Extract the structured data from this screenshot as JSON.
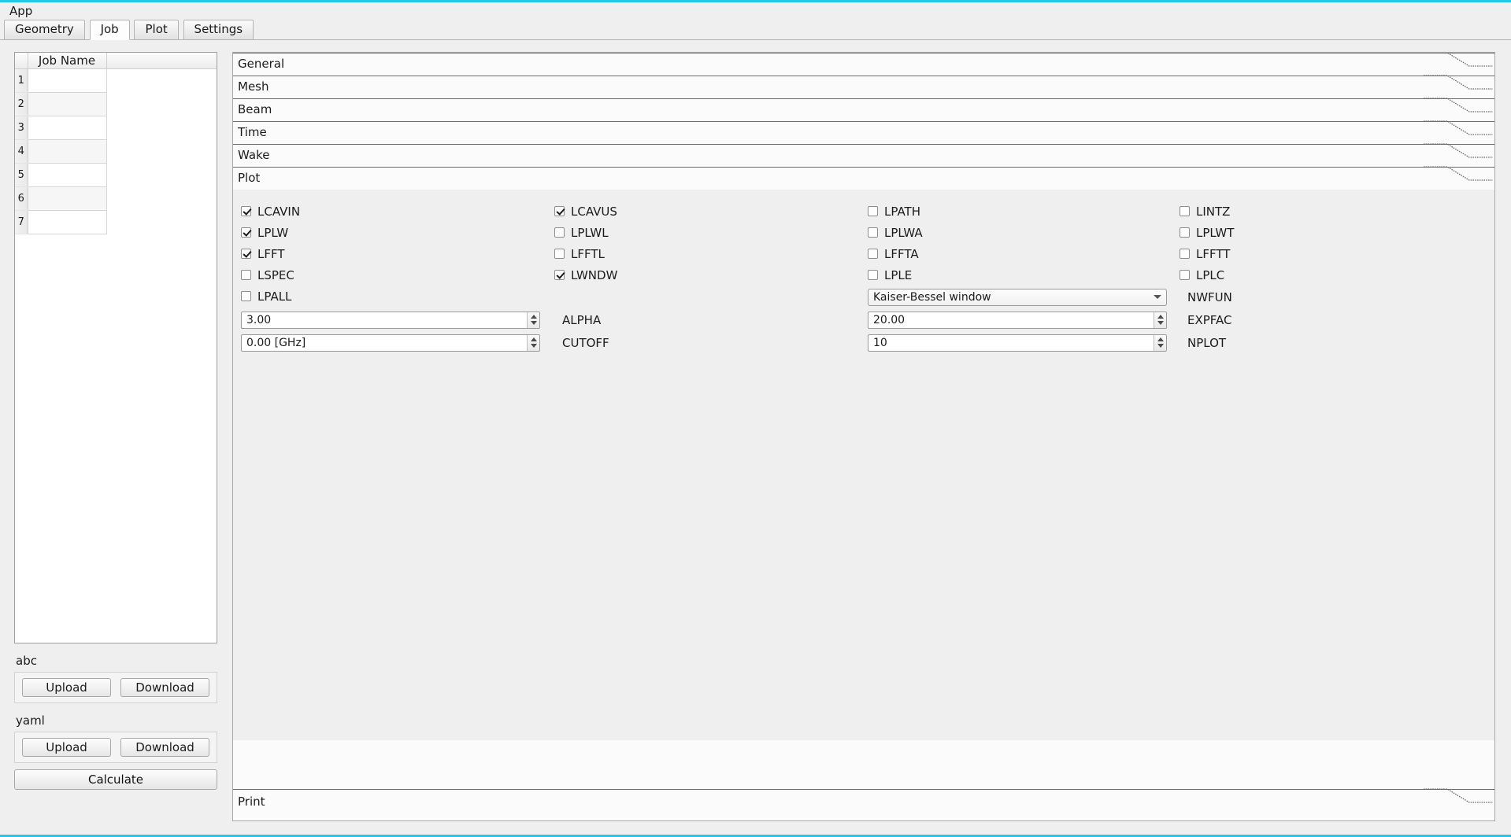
{
  "window": {
    "title": "App",
    "accent_color": "#22c8e8"
  },
  "tabs": [
    {
      "label": "Geometry",
      "active": false
    },
    {
      "label": "Job",
      "active": true
    },
    {
      "label": "Plot",
      "active": false
    },
    {
      "label": "Settings",
      "active": false
    }
  ],
  "job_table": {
    "column_header": "Job Name",
    "rows": [
      {
        "index": "1",
        "job_name": ""
      },
      {
        "index": "2",
        "job_name": ""
      },
      {
        "index": "3",
        "job_name": ""
      },
      {
        "index": "4",
        "job_name": ""
      },
      {
        "index": "5",
        "job_name": ""
      },
      {
        "index": "6",
        "job_name": ""
      },
      {
        "index": "7",
        "job_name": ""
      }
    ]
  },
  "io_groups": [
    {
      "label": "abc",
      "upload": "Upload",
      "download": "Download"
    },
    {
      "label": "yaml",
      "upload": "Upload",
      "download": "Download"
    }
  ],
  "calculate_label": "Calculate",
  "sections": [
    {
      "label": "General"
    },
    {
      "label": "Mesh"
    },
    {
      "label": "Beam"
    },
    {
      "label": "Time"
    },
    {
      "label": "Wake"
    },
    {
      "label": "Plot",
      "expanded": true
    }
  ],
  "print_section": {
    "label": "Print"
  },
  "plot": {
    "checkboxes": [
      {
        "name": "LCAVIN",
        "checked": true
      },
      {
        "name": "LCAVUS",
        "checked": true
      },
      {
        "name": "LPATH",
        "checked": false
      },
      {
        "name": "LINTZ",
        "checked": false
      },
      {
        "name": "LPLW",
        "checked": true
      },
      {
        "name": "LPLWL",
        "checked": false
      },
      {
        "name": "LPLWA",
        "checked": false
      },
      {
        "name": "LPLWT",
        "checked": false
      },
      {
        "name": "LFFT",
        "checked": true
      },
      {
        "name": "LFFTL",
        "checked": false
      },
      {
        "name": "LFFTA",
        "checked": false
      },
      {
        "name": "LFFTT",
        "checked": false
      },
      {
        "name": "LSPEC",
        "checked": false
      },
      {
        "name": "LWNDW",
        "checked": true
      },
      {
        "name": "LPLE",
        "checked": false
      },
      {
        "name": "LPLC",
        "checked": false
      },
      {
        "name": "LPALL",
        "checked": false
      }
    ],
    "nwfun": {
      "label": "NWFUN",
      "value": "Kaiser-Bessel window",
      "control": "combobox"
    },
    "alpha": {
      "label": "ALPHA",
      "value": "3.00",
      "control": "spinbox"
    },
    "expfac": {
      "label": "EXPFAC",
      "value": "20.00",
      "control": "spinbox"
    },
    "cutoff": {
      "label": "CUTOFF",
      "value": "0.00 [GHz]",
      "control": "spinbox"
    },
    "nplot": {
      "label": "NPLOT",
      "value": "10",
      "control": "spinbox"
    }
  },
  "icons": {
    "spin_up": "triangle-up-icon",
    "spin_down": "triangle-down-icon",
    "combo_caret": "chevron-down-icon",
    "checkmark": "check-icon"
  }
}
